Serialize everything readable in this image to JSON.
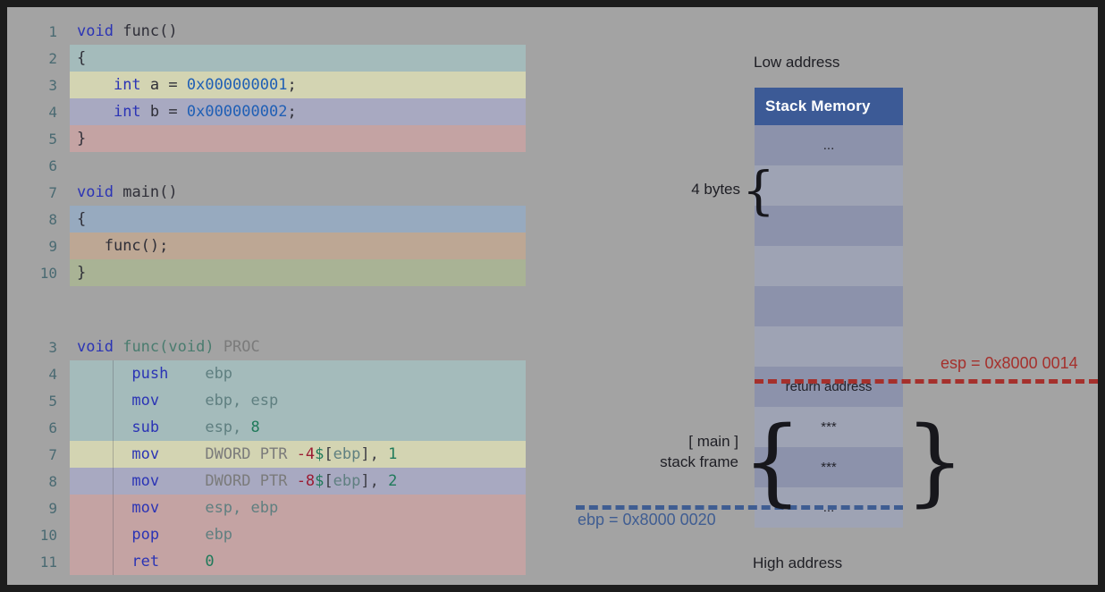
{
  "slide": {
    "background": "#a3a3a3",
    "frame_color": "#1c1c1c"
  },
  "c_source": {
    "lines": [
      {
        "num": "1",
        "highlight": "none",
        "tokens": [
          {
            "t": "void",
            "c": "kw"
          },
          {
            "t": " ",
            "c": "plain"
          },
          {
            "t": "func",
            "c": "fn"
          },
          {
            "t": "()",
            "c": "plain"
          }
        ]
      },
      {
        "num": "2",
        "highlight": "teal",
        "tokens": [
          {
            "t": "{",
            "c": "plain"
          }
        ]
      },
      {
        "num": "3",
        "highlight": "khaki",
        "tokens": [
          {
            "t": "    ",
            "c": "plain"
          },
          {
            "t": "int",
            "c": "kw"
          },
          {
            "t": " a = ",
            "c": "plain"
          },
          {
            "t": "0x000000001",
            "c": "num"
          },
          {
            "t": ";",
            "c": "plain"
          }
        ]
      },
      {
        "num": "4",
        "highlight": "violet",
        "tokens": [
          {
            "t": "    ",
            "c": "plain"
          },
          {
            "t": "int",
            "c": "kw"
          },
          {
            "t": " b = ",
            "c": "plain"
          },
          {
            "t": "0x000000002",
            "c": "num"
          },
          {
            "t": ";",
            "c": "plain"
          }
        ]
      },
      {
        "num": "5",
        "highlight": "rose",
        "tokens": [
          {
            "t": "}",
            "c": "plain"
          }
        ]
      },
      {
        "num": "6",
        "highlight": "none",
        "tokens": [
          {
            "t": "",
            "c": "plain"
          }
        ]
      },
      {
        "num": "7",
        "highlight": "none",
        "tokens": [
          {
            "t": "void",
            "c": "kw"
          },
          {
            "t": " ",
            "c": "plain"
          },
          {
            "t": "main",
            "c": "fn"
          },
          {
            "t": "()",
            "c": "plain"
          }
        ]
      },
      {
        "num": "8",
        "highlight": "blue",
        "tokens": [
          {
            "t": "{",
            "c": "plain"
          }
        ]
      },
      {
        "num": "9",
        "highlight": "tan",
        "tokens": [
          {
            "t": "   ",
            "c": "plain"
          },
          {
            "t": "func",
            "c": "fn"
          },
          {
            "t": "();",
            "c": "plain"
          }
        ]
      },
      {
        "num": "10",
        "highlight": "olive",
        "tokens": [
          {
            "t": "}",
            "c": "plain"
          }
        ]
      }
    ]
  },
  "asm_source": {
    "lines": [
      {
        "num": "3",
        "highlight": "none",
        "sep": false,
        "tokens": [
          {
            "t": "void",
            "c": "kw"
          },
          {
            "t": " ",
            "c": "plain"
          },
          {
            "t": "func(void)",
            "c": "proc"
          },
          {
            "t": " ",
            "c": "plain"
          },
          {
            "t": "PROC",
            "c": "dword"
          }
        ]
      },
      {
        "num": "4",
        "highlight": "teal",
        "sep": true,
        "tokens": [
          {
            "t": "      ",
            "c": "plain"
          },
          {
            "t": "push",
            "c": "mn"
          },
          {
            "t": "    ",
            "c": "plain"
          },
          {
            "t": "ebp",
            "c": "reg"
          }
        ]
      },
      {
        "num": "5",
        "highlight": "teal",
        "sep": true,
        "tokens": [
          {
            "t": "      ",
            "c": "plain"
          },
          {
            "t": "mov",
            "c": "mn"
          },
          {
            "t": "     ",
            "c": "plain"
          },
          {
            "t": "ebp, esp",
            "c": "reg"
          }
        ]
      },
      {
        "num": "6",
        "highlight": "teal",
        "sep": true,
        "tokens": [
          {
            "t": "      ",
            "c": "plain"
          },
          {
            "t": "sub",
            "c": "mn"
          },
          {
            "t": "     ",
            "c": "plain"
          },
          {
            "t": "esp, ",
            "c": "reg"
          },
          {
            "t": "8",
            "c": "imm"
          }
        ]
      },
      {
        "num": "7",
        "highlight": "khaki",
        "sep": true,
        "tokens": [
          {
            "t": "      ",
            "c": "plain"
          },
          {
            "t": "mov",
            "c": "mn"
          },
          {
            "t": "     ",
            "c": "plain"
          },
          {
            "t": "DWORD PTR ",
            "c": "dword"
          },
          {
            "t": "-4",
            "c": "neg"
          },
          {
            "t": "$",
            "c": "dollar"
          },
          {
            "t": "[",
            "c": "brk"
          },
          {
            "t": "ebp",
            "c": "reg"
          },
          {
            "t": "]",
            "c": "brk"
          },
          {
            "t": ", ",
            "c": "brk"
          },
          {
            "t": "1",
            "c": "imm"
          }
        ]
      },
      {
        "num": "8",
        "highlight": "violet",
        "sep": true,
        "tokens": [
          {
            "t": "      ",
            "c": "plain"
          },
          {
            "t": "mov",
            "c": "mn"
          },
          {
            "t": "     ",
            "c": "plain"
          },
          {
            "t": "DWORD PTR ",
            "c": "dword"
          },
          {
            "t": "-8",
            "c": "neg"
          },
          {
            "t": "$",
            "c": "dollar"
          },
          {
            "t": "[",
            "c": "brk"
          },
          {
            "t": "ebp",
            "c": "reg"
          },
          {
            "t": "]",
            "c": "brk"
          },
          {
            "t": ", ",
            "c": "brk"
          },
          {
            "t": "2",
            "c": "imm"
          }
        ]
      },
      {
        "num": "9",
        "highlight": "rose",
        "sep": true,
        "tokens": [
          {
            "t": "      ",
            "c": "plain"
          },
          {
            "t": "mov",
            "c": "mn"
          },
          {
            "t": "     ",
            "c": "plain"
          },
          {
            "t": "esp, ebp",
            "c": "reg"
          }
        ]
      },
      {
        "num": "10",
        "highlight": "rose",
        "sep": true,
        "tokens": [
          {
            "t": "      ",
            "c": "plain"
          },
          {
            "t": "pop",
            "c": "mn"
          },
          {
            "t": "     ",
            "c": "plain"
          },
          {
            "t": "ebp",
            "c": "reg"
          }
        ]
      },
      {
        "num": "11",
        "highlight": "rose",
        "sep": true,
        "tokens": [
          {
            "t": "      ",
            "c": "plain"
          },
          {
            "t": "ret",
            "c": "mn"
          },
          {
            "t": "     ",
            "c": "plain"
          },
          {
            "t": "0",
            "c": "imm"
          }
        ]
      }
    ]
  },
  "stack": {
    "low_address_label": "Low address",
    "high_address_label": "High address",
    "header_label": "Stack Memory",
    "bytes_label": "4 bytes",
    "frame_label_line1": "[ main ]",
    "frame_label_line2": "stack frame",
    "esp_label": "esp = 0x8000 0014",
    "ebp_label": "ebp = 0x8000 0020",
    "esp_color": "#a5302c",
    "ebp_color": "#3f5d92",
    "header_color": "#3c5a96",
    "cells": [
      {
        "label": "...",
        "tone": "dark"
      },
      {
        "label": "",
        "tone": "light"
      },
      {
        "label": "",
        "tone": "dark"
      },
      {
        "label": "",
        "tone": "light"
      },
      {
        "label": "",
        "tone": "dark"
      },
      {
        "label": "",
        "tone": "light"
      },
      {
        "label": "return address",
        "tone": "dark"
      },
      {
        "label": "***",
        "tone": "light"
      },
      {
        "label": "***",
        "tone": "dark"
      },
      {
        "label": "...",
        "tone": "light"
      }
    ]
  }
}
